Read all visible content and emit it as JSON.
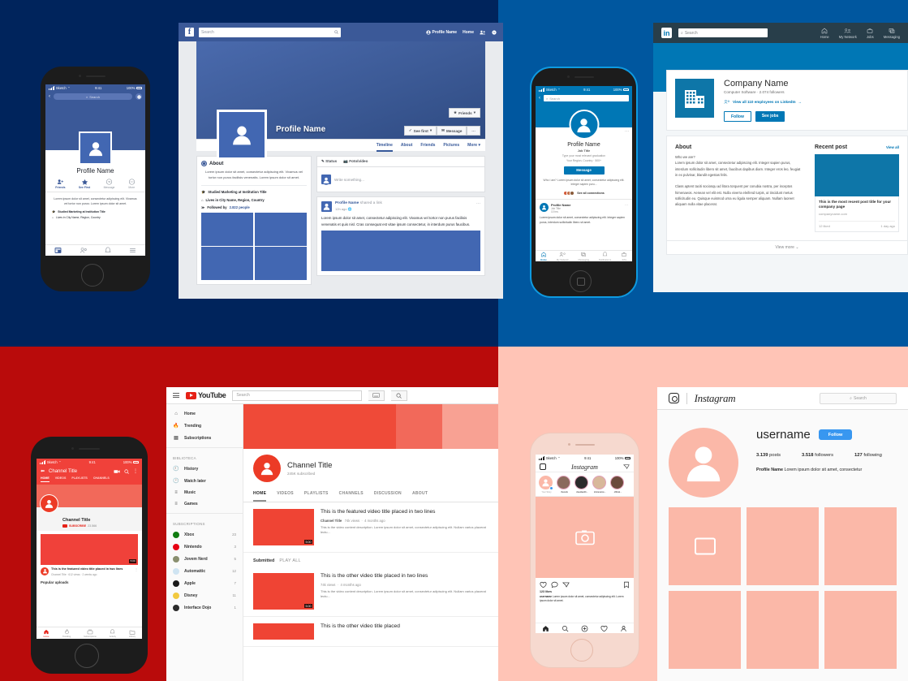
{
  "facebook": {
    "nav": {
      "search_placeholder": "Search",
      "profile_name": "Profile Name",
      "home": "Home"
    },
    "cover": {
      "profile_name": "Profile Name"
    },
    "buttons": {
      "friends": "Friends",
      "see_first": "See first",
      "message": "Message",
      "more_dots": "···"
    },
    "tabs": [
      "Timeline",
      "About",
      "Friends",
      "Pictures",
      "More"
    ],
    "about": {
      "heading": "About",
      "text": "Lorem ipsum dolor sit amet, consectetur adipiscing elit. Vivamus vel tortor non purus facilisis venenatis. Lorem ipsum dolor sit amet.",
      "education": "Studied Marketing at Institution Title",
      "location": "Lives in City Name, Region, Country",
      "followed_label": "Followed by",
      "followed_count": "2.822 people"
    },
    "composer": {
      "status": "Status",
      "photo_video": "Foto/vídeo",
      "placeholder": "Write something..."
    },
    "post": {
      "author": "Profile Name",
      "action": "shared a link",
      "time": "12h ago",
      "text": "Lorem ipsum dolor sit amet, consectetur adipiscing elit. Vivamus vel tortor non purus facilisis venenatis et quis nisl. Cras consequat est vitae ipsum consectetur, in interdum purus faucibus."
    }
  },
  "facebook_mobile": {
    "status": {
      "carrier": "Sketch",
      "time": "9:41",
      "battery": "100%"
    },
    "search_placeholder": "Search",
    "profile_name": "Profile Name",
    "actions": [
      "Friends",
      "See First",
      "Message",
      "More"
    ],
    "bio": "Lorem ipsum dolor sit amet, consectetur adipiscing elit. Vivamus vel tortor non purus: Lorem ipsum dolor sit amet.",
    "education": "Studied Marketing at Institution Title",
    "location": "Lives in City Name, Region, Country"
  },
  "linkedin": {
    "nav": {
      "search_placeholder": "Search",
      "items": [
        "Home",
        "My Network",
        "Jobs",
        "Messaging"
      ]
    },
    "company": {
      "name": "Company Name",
      "subtitle": "Computer Software · 2.074 followers",
      "employees_link": "View all 110 employees on LinkedIn",
      "follow": "Follow",
      "see_jobs": "See jobs"
    },
    "about": {
      "heading": "About",
      "lead": "Who we are?",
      "p1": "Lorem ipsum dolor sit amet, consectetur adipiscing elit. Integer sapien purus, interdum sollicitudin libero sit amet, faucibus dapibus diam. Integer eros leo, feugiat in ex pulvinar, blandit egestas felis.",
      "p2": "Class aptent taciti sociosqu ad litora torquent per conubia nostra, per inceptos himenaeos. Aenean vel elit est. Nulla viverra eleifend turpis, ut tincidunt metus sollicitudin eu. Quisque euismod urna eu ligula semper aliquam. Nullam laoreet aliquam nulla vitae placerat."
    },
    "recent_post": {
      "heading": "Recent post",
      "view_all": "View all",
      "title": "This is the most recent post title for your company page",
      "domain": "companyname.com",
      "likes": "12 liked",
      "time": "1 day ago"
    },
    "view_more": "View more"
  },
  "linkedin_mobile": {
    "status": {
      "carrier": "Sketch",
      "time": "9:41",
      "battery": "100%"
    },
    "search_placeholder": "Search",
    "profile_name": "Profile Name",
    "job_title": "Job Title",
    "graduation": "Type your most relevant graduation",
    "region": "Your Region, Country  ·  500+",
    "message": "Message",
    "summary": "Who I am? Lorem ipsum dolor sit amet, consectetur adipiscing elit. Integer sapien puru...",
    "connections": "See all connections",
    "feed_author": "Profile Name",
    "feed_job": "Job Title",
    "feed_time": "10 hrs",
    "feed_text": "Lorem ipsum dolor sit amet, consectetur adipiscing elit. Integer sapien purus, interdum sollicitudin libero sit amet.",
    "tabs": [
      "Home",
      "My Network",
      "Messaging",
      "Notifications",
      "Jobs"
    ]
  },
  "youtube": {
    "nav": {
      "search_placeholder": "Search"
    },
    "sidebar": {
      "main": [
        "Home",
        "Trending",
        "Subscriptions"
      ],
      "library_label": "BIBLIOTECA",
      "library": [
        "History",
        "Watch later",
        "Music",
        "Games"
      ],
      "subs_label": "SUBSCRIPTIONS",
      "subs": [
        {
          "name": "Xbox",
          "count": "23",
          "color": "#107c10"
        },
        {
          "name": "Nintendo",
          "count": "3",
          "color": "#e60012"
        },
        {
          "name": "Jovem Nerd",
          "count": "5",
          "color": "#8a8f6f"
        },
        {
          "name": "Automattic",
          "count": "12",
          "color": "#cfe4f2"
        },
        {
          "name": "Apple",
          "count": "7",
          "color": "#1a1a1a"
        },
        {
          "name": "Disney",
          "count": "11",
          "color": "#f2c93f"
        },
        {
          "name": "Interface Dojo",
          "count": "1",
          "color": "#2b2b2b"
        }
      ]
    },
    "channel": {
      "title": "Channel Title",
      "subs": "245K subscribed"
    },
    "tabs": [
      "HOME",
      "VIDEOS",
      "PLAYLISTS",
      "CHANNELS",
      "DISCUSSION",
      "ABOUT"
    ],
    "featured": {
      "title": "This is the featured video title placed in two lines",
      "channel": "Channel Title",
      "views": "74k views",
      "age": "4 months ago",
      "desc": "This is the video content description. Lorem ipsum dolor sit amet, consectetur adipiscing elit. Nullam varius placerat lectu...",
      "duration": "5:00"
    },
    "section": {
      "label": "Submitted",
      "play_all": "PLAY ALL"
    },
    "videos": [
      {
        "title": "This is the other video title placed in two lines",
        "views": "74k views",
        "age": "4 months ago",
        "desc": "This is the video content description. Lorem ipsum dolor sit amet, consectetur adipiscing elit. Nullam varius placerat lectu...",
        "duration": "5:00"
      },
      {
        "title": "This is the other video title placed",
        "views": "",
        "age": "",
        "desc": "",
        "duration": ""
      }
    ]
  },
  "youtube_mobile": {
    "status": {
      "carrier": "Sketch",
      "time": "9:41",
      "battery": "100%"
    },
    "title": "Channel Title",
    "tabs": [
      "HOME",
      "VIDEOS",
      "PLAYLISTS",
      "CHANNELS"
    ],
    "channel_title": "Channel Title",
    "subscribe": "SUBSCRIBE",
    "sub_count": "23.566",
    "video_title": "This is the featured video title placed in two lines",
    "video_meta": "Channel Title · 612 views · 2 weeks ago",
    "section": "Popular uploads",
    "duration": "5:00",
    "tabbar": [
      "Home",
      "Trending",
      "Subscriptions",
      "Activity",
      "Library"
    ]
  },
  "instagram": {
    "wordmark": "Instagram",
    "search_placeholder": "Search",
    "username": "username",
    "follow": "Follow",
    "stats": {
      "posts_n": "3.139",
      "posts_l": "posts",
      "followers_n": "3.518",
      "followers_l": "followers",
      "following_n": "127",
      "following_l": "following"
    },
    "bio_name": "Profile Name",
    "bio_text": "Lorem ipsum dolor sit amet, consectetur"
  },
  "instagram_mobile": {
    "status": {
      "carrier": "Sketch",
      "time": "9:41",
      "battery": "100%"
    },
    "wordmark": "Instagram",
    "stories": [
      "Your Story",
      "thereds",
      "claudiaobb...",
      "kristenarce...",
      "official..."
    ],
    "likes": "123 likes",
    "caption_user": "username",
    "caption": "Lorem ipsum dolor sit amet, consectetur adipiscing elit. Lorem ipsum dolor sit amet."
  },
  "colors": {
    "fb_blue": "#3b5998",
    "li_blue": "#0077b5",
    "yt_red": "#e62117",
    "ig_blue": "#3897f0"
  }
}
